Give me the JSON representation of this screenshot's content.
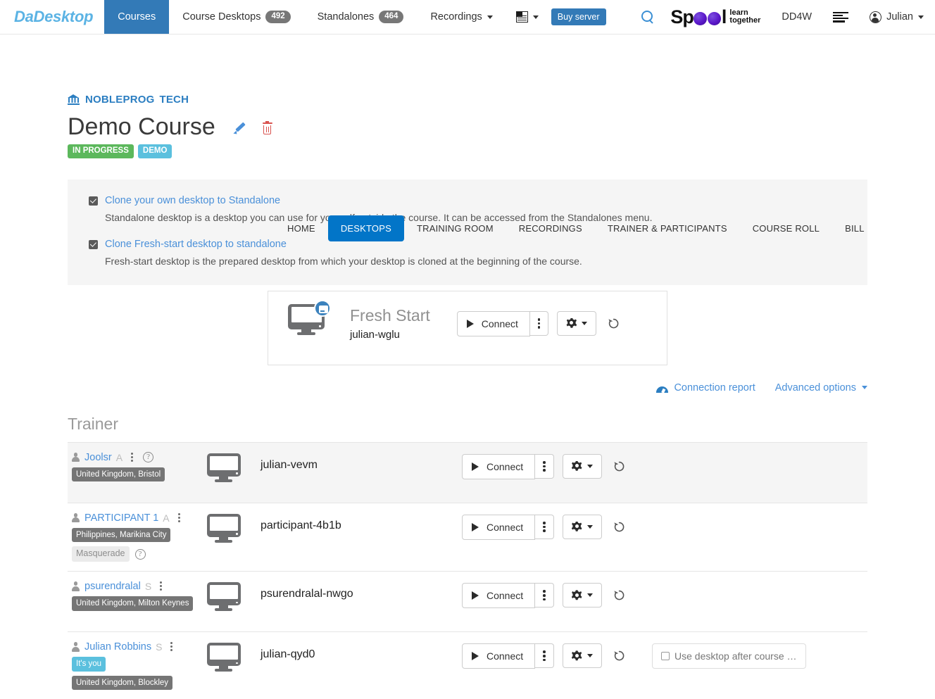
{
  "navbar": {
    "brand": "DaDesktop",
    "items": [
      {
        "label": "Courses",
        "badge": null,
        "active": true,
        "caret": false
      },
      {
        "label": "Course Desktops",
        "badge": "492",
        "active": false,
        "caret": false
      },
      {
        "label": "Standalones",
        "badge": "464",
        "active": false,
        "caret": false
      },
      {
        "label": "Recordings",
        "badge": null,
        "active": false,
        "caret": true
      }
    ],
    "flag_icon": "flag-icon",
    "buy_server_label": "Buy server",
    "search_icon": "search-icon",
    "logo": {
      "prefix": "Sp",
      "suffix": "l",
      "tagline_line1": "learn",
      "tagline_line2": "together"
    },
    "org_code": "DD4W",
    "list_icon": "list-icon",
    "user_name": "Julian"
  },
  "breadcrumb": {
    "icon": "bank-icon",
    "org_part1": "NOBLEPROG",
    "org_part2": "TECH"
  },
  "course": {
    "title": "Demo Course",
    "edit_icon": "pencil-icon",
    "delete_icon": "trash-icon",
    "badges": [
      {
        "label": "IN PROGRESS",
        "color": "#5cb85c"
      },
      {
        "label": "DEMO",
        "color": "#5bc0de"
      }
    ]
  },
  "tabs": [
    {
      "label": "HOME",
      "active": false
    },
    {
      "label": "DESKTOPS",
      "active": true
    },
    {
      "label": "TRAINING ROOM",
      "active": false
    },
    {
      "label": "RECORDINGS",
      "active": false
    },
    {
      "label": "TRAINER & PARTICIPANTS",
      "active": false
    },
    {
      "label": "COURSE ROLL",
      "active": false
    },
    {
      "label": "BILL",
      "active": false
    }
  ],
  "clone_options": [
    {
      "checked": true,
      "link": "Clone your own desktop to Standalone",
      "description": "Standalone desktop is a desktop you can use for yourself outside the course. It can be accessed from the Standalones menu."
    },
    {
      "checked": true,
      "link": "Clone Fresh-start desktop to standalone",
      "description": "Fresh-start desktop is the prepared desktop from which your desktop is cloned at the beginning of the course."
    }
  ],
  "fresh_start": {
    "name": "Fresh Start",
    "hostname": "julian-wglu",
    "icon": "monitor-with-disk-badge-icon",
    "connect_label": "Connect"
  },
  "links": {
    "connection_report": "Connection report",
    "advanced_options": "Advanced options"
  },
  "section": {
    "trainer_title": "Trainer"
  },
  "buttons": {
    "connect_label": "Connect",
    "play_icon": "play-icon",
    "kebab_icon": "kebab-icon",
    "gear_icon": "gear-icon",
    "restore_icon": "restore-icon"
  },
  "rows": [
    {
      "person": "Joolsr",
      "role": "A",
      "has_help": true,
      "location": "United Kingdom, Bristol",
      "masquerade": null,
      "you_badge": null,
      "hostname": "julian-vevm",
      "shaded": true,
      "after_course": null
    },
    {
      "person": "PARTICIPANT 1",
      "role": "A",
      "has_help": false,
      "location": "Philippines, Marikina City",
      "masquerade": "Masquerade",
      "you_badge": null,
      "hostname": "participant-4b1b",
      "shaded": false,
      "after_course": null
    },
    {
      "person": "psurendralal",
      "role": "S",
      "has_help": false,
      "location": "United Kingdom, Milton Keynes",
      "masquerade": null,
      "you_badge": null,
      "hostname": "psurendralal-nwgo",
      "shaded": false,
      "after_course": null
    },
    {
      "person": "Julian Robbins",
      "role": "S",
      "has_help": false,
      "location": "United Kingdom, Blockley",
      "masquerade": null,
      "you_badge": "It's you",
      "hostname": "julian-qyd0",
      "shaded": false,
      "after_course": "Use desktop after course …"
    }
  ],
  "colors": {
    "primary_blue": "#337ab7",
    "tab_active": "#0275c8",
    "link_blue": "#4a90d9",
    "brand_blue": "#5bb3e4",
    "badge_gray": "#777777",
    "success_green": "#5cb85c",
    "info_blue": "#5bc0de",
    "danger_red": "#d9534f"
  }
}
